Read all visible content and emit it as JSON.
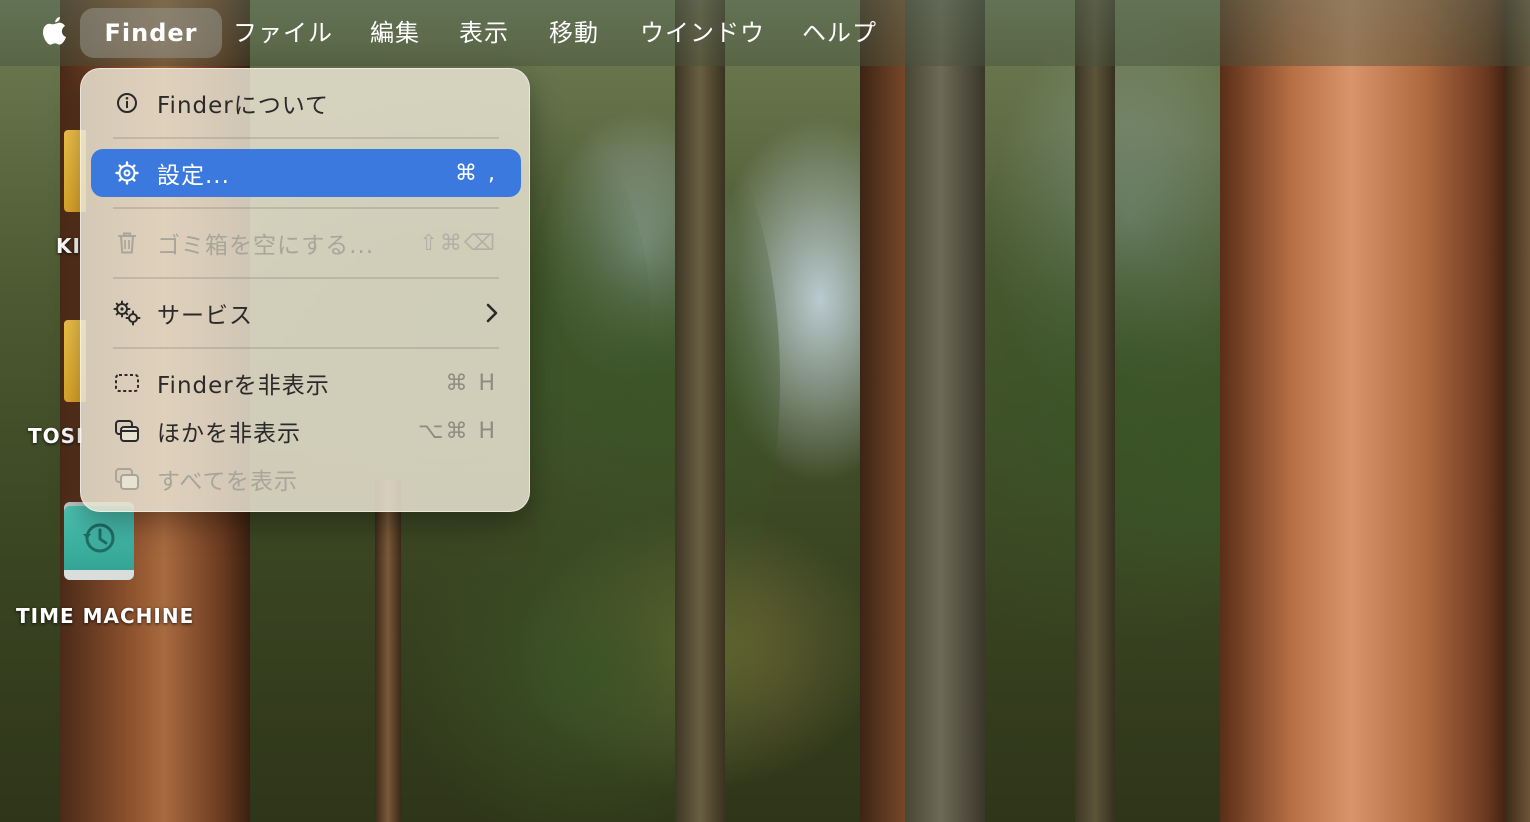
{
  "menubar": {
    "app_name": "Finder",
    "menus": [
      "ファイル",
      "編集",
      "表示",
      "移動",
      "ウインドウ",
      "ヘルプ"
    ]
  },
  "desktop": {
    "icons": [
      {
        "label": "KI",
        "type": "external-disk"
      },
      {
        "label": "TOSI",
        "type": "external-disk"
      },
      {
        "label": "TIME MACHINE",
        "type": "time-machine-disk"
      }
    ]
  },
  "finder_menu": {
    "items": [
      {
        "label": "Finderについて",
        "icon": "info-icon",
        "shortcut": "",
        "state": "normal"
      },
      {
        "label": "設定...",
        "icon": "gear-icon",
        "shortcut": "⌘ ,",
        "state": "highlighted"
      },
      {
        "label": "ゴミ箱を空にする...",
        "icon": "trash-icon",
        "shortcut": "⇧⌘⌫",
        "state": "disabled"
      },
      {
        "label": "サービス",
        "icon": "services-gears-icon",
        "shortcut": "",
        "state": "normal",
        "submenu": true
      },
      {
        "label": "Finderを非表示",
        "icon": "hide-window-icon",
        "shortcut": "⌘ H",
        "state": "normal"
      },
      {
        "label": "ほかを非表示",
        "icon": "hide-others-icon",
        "shortcut": "⌥⌘ H",
        "state": "normal"
      },
      {
        "label": "すべてを表示",
        "icon": "show-all-icon",
        "shortcut": "",
        "state": "disabled"
      }
    ]
  },
  "colors": {
    "highlight": "#3b79df",
    "menu_bg": "#e8e2d0",
    "disabled_text": "#a8a59b"
  }
}
